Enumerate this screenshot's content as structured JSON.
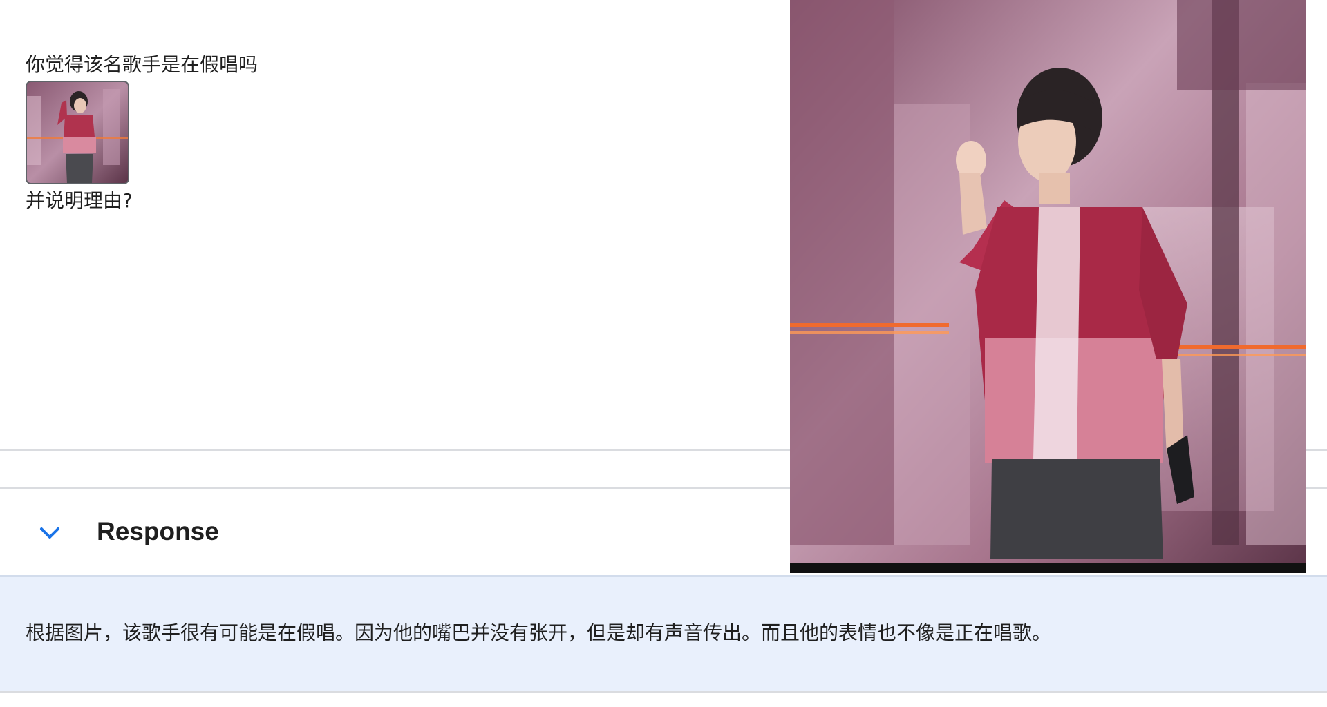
{
  "prompt": {
    "line1": "你觉得该名歌手是在假唱吗",
    "line2": "并说明理由?"
  },
  "response": {
    "title": "Response",
    "text": "根据图片，该歌手很有可能是在假唱。因为他的嘴巴并没有张开，但是却有声音传出。而且他的表情也不像是正在唱歌。"
  },
  "icons": {
    "toggle": "chevron-down-icon"
  },
  "colors": {
    "accent": "#1a73e8",
    "response_bg": "#e9f0fc",
    "separator": "#dadce0"
  }
}
